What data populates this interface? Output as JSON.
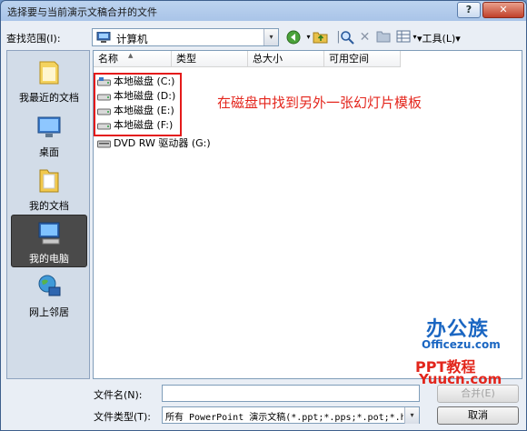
{
  "window": {
    "title": "选择要与当前演示文稿合并的文件",
    "help": "?",
    "close": "✕"
  },
  "toolbar": {
    "look_in_label": "查找范围(I):",
    "look_in_value": "计算机",
    "tools_label": "工具(L)",
    "arrow": "▾"
  },
  "places": [
    {
      "label": "我最近的文档",
      "icon": "recent-folder-icon"
    },
    {
      "label": "桌面",
      "icon": "desktop-icon"
    },
    {
      "label": "我的文档",
      "icon": "documents-folder-icon"
    },
    {
      "label": "我的电脑",
      "icon": "computer-icon"
    },
    {
      "label": "网上邻居",
      "icon": "network-icon"
    }
  ],
  "columns": [
    "名称",
    "类型",
    "总大小",
    "可用空间"
  ],
  "files": [
    {
      "name": "本地磁盘 (C:)",
      "icon": "system-drive-icon"
    },
    {
      "name": "本地磁盘 (D:)",
      "icon": "drive-icon"
    },
    {
      "name": "本地磁盘 (E:)",
      "icon": "drive-icon"
    },
    {
      "name": "本地磁盘 (F:)",
      "icon": "drive-icon"
    },
    {
      "name": "DVD RW 驱动器 (G:)",
      "icon": "dvd-drive-icon"
    }
  ],
  "annotation": "在磁盘中找到另外一张幻灯片模板",
  "watermark": {
    "brand": "办公族",
    "site1": "Officezu.com",
    "ppt": "PPT教程",
    "site2": "Yuucn.com"
  },
  "bottom": {
    "filename_label": "文件名(N):",
    "filename_value": "",
    "filetype_label": "文件类型(T):",
    "filetype_value": "所有 PowerPoint 演示文稿(*.ppt;*.pps;*.pot;*.h",
    "merge_button": "合并(E)",
    "cancel_button": "取消"
  }
}
